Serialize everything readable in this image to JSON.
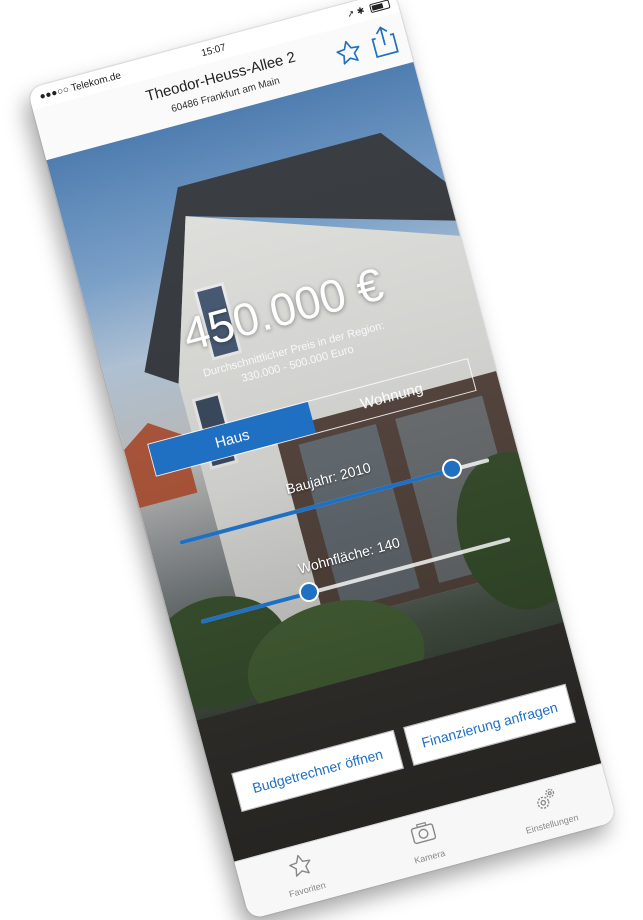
{
  "status_bar": {
    "carrier": "●●●○○ Telekom.de",
    "time": "15:07",
    "icons": "➚ ✱"
  },
  "header": {
    "title": "Theodor-Heuss-Allee 2",
    "subtitle": "60486 Frankfurt am Main"
  },
  "hero": {
    "price": "450.000 €",
    "price_note_line1": "Durchschnittlicher Preis in der Region:",
    "price_note_line2": "330.000 - 500.000 Euro"
  },
  "segment": {
    "options": [
      "Haus",
      "Wohnung"
    ],
    "selected": "Haus"
  },
  "sliders": {
    "baujahr": {
      "label": "Baujahr: 2010",
      "fraction": 0.88
    },
    "wohnflaeche": {
      "label": "Wohnfläche: 140",
      "fraction": 0.35
    }
  },
  "actions": {
    "budget": "Budgetrechner öffnen",
    "financing": "Finanzierung anfragen"
  },
  "tabs": [
    {
      "label": "Favoriten",
      "icon": "star-icon"
    },
    {
      "label": "Kamera",
      "icon": "camera-icon"
    },
    {
      "label": "Einstellungen",
      "icon": "gears-icon"
    }
  ],
  "colors": {
    "accent": "#1f6fc2",
    "tab_inactive": "#888888"
  }
}
